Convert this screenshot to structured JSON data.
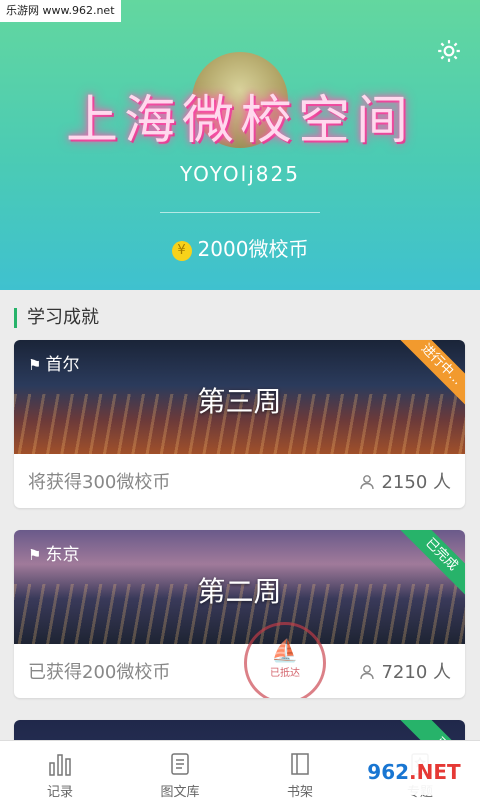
{
  "watermark": "乐游网 www.962.net",
  "banner": {
    "title": "上海微校空间"
  },
  "user": {
    "name": "YOYOlj825",
    "coins_text": "2000微校币",
    "coin_symbol": "¥"
  },
  "section": {
    "title": "学习成就"
  },
  "cards": [
    {
      "city": "首尔",
      "week": "第三周",
      "status": "进行中...",
      "reward": "将获得300微校币",
      "people": "2150 人",
      "status_color": "#f29a2e"
    },
    {
      "city": "东京",
      "week": "第二周",
      "status": "已完成",
      "reward": "已获得200微校币",
      "people": "7210 人",
      "status_color": "#27b36a",
      "stamp_text": "已抵达"
    },
    {
      "status": "已"
    }
  ],
  "nav": [
    {
      "label": "记录",
      "icon": "bar-chart-icon"
    },
    {
      "label": "图文库",
      "icon": "document-icon"
    },
    {
      "label": "书架",
      "icon": "book-icon"
    },
    {
      "label": "专题",
      "icon": "star-doc-icon"
    }
  ],
  "brand": {
    "text": "962",
    "suffix": ".NET",
    "sub": "乐游网"
  }
}
